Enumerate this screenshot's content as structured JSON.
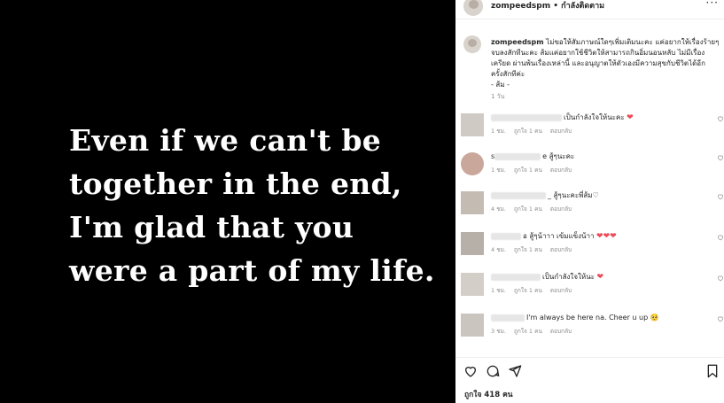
{
  "post": {
    "quote": "Even if we can't be\ntogether in the end,\nI'm glad that you\nwere a part of my life."
  },
  "header": {
    "username": "zompeedspm",
    "separator": "•",
    "follow_label": "กำลังติดตาม",
    "more": "···"
  },
  "caption": {
    "username": "zompeedspm",
    "text": " ไม่ขอให้สัมภาษณ์ใดๆเพิ่มเติมนะคะ แค่อยากให้เรื่องร้ายๆ จบลงสักทีนะคะ ส้มแค่อยากใช้ชีวิตให้สามารถกินอิ่มนอนหลับ ไม่มีเรื่อง เครียด ผ่านพ้นเรื่องเหล่านี้ และอนุญาตให้ตัวเองมีความสุขกับชีวิตได้อีก ครั้งสักทีค่ะ",
    "signature": "- ส้ม -",
    "time": "1 วัน"
  },
  "comments": [
    {
      "prefix": "",
      "text": "เป็นกำลังใจให้นะคะ",
      "hearts": "❤",
      "meta": [
        "1 ชม.",
        "ถูกใจ 1 คน",
        "ตอบกลับ"
      ]
    },
    {
      "prefix": "s",
      "text": "e สู้ๆนะคะ",
      "hearts": "",
      "meta": [
        "1 ชม.",
        "ถูกใจ 1 คน",
        "ตอบกลับ"
      ]
    },
    {
      "prefix": "",
      "text": "_ สู้ๆนะคะพี่ส้ม♡",
      "hearts": "",
      "meta": [
        "4 ชม.",
        "ถูกใจ 1 คน",
        "ตอบกลับ"
      ]
    },
    {
      "prefix": "",
      "text": "อ สู้ๆน้าาา เข้มแข็งน้าา",
      "hearts": "❤❤❤",
      "meta": [
        "4 ชม.",
        "ถูกใจ 1 คน",
        "ตอบกลับ"
      ]
    },
    {
      "prefix": "",
      "text": "เป็นกำลังใจให้นะ",
      "hearts": "❤",
      "meta": [
        "1 ชม.",
        "ถูกใจ 1 คน",
        "ตอบกลับ"
      ]
    },
    {
      "prefix": "",
      "text": "I'm always be here na. Cheer u up",
      "hearts": "🥺",
      "meta": [
        "3 ชม.",
        "ถูกใจ 1 คน",
        "ตอบกลับ"
      ]
    }
  ],
  "comment_like_icon": "heart-outline-icon",
  "footer": {
    "likes": "ถูกใจ 418 คน"
  },
  "icons": [
    "heart-outline-icon",
    "comment-icon",
    "share-icon",
    "bookmark-icon"
  ],
  "colors": {
    "like_red": "#ed4956",
    "text": "#262626",
    "muted": "#8e8e8e"
  }
}
